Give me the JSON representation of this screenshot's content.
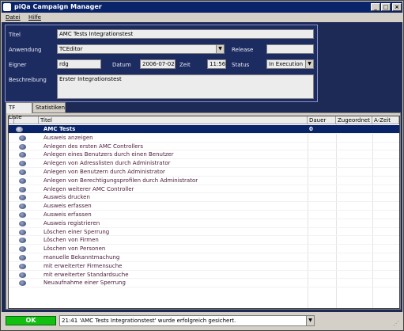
{
  "window": {
    "title": "piQa Campaign Manager"
  },
  "menu": [
    {
      "label": "Datei"
    },
    {
      "label": "Hilfe"
    }
  ],
  "form": {
    "titel_label": "Titel",
    "titel_value": "AMC Tests Integrationstest",
    "anwendung_label": "Anwendung",
    "anwendung_value": "TCEditor",
    "release_label": "Release",
    "release_value": "",
    "eigner_label": "Eigner",
    "eigner_value": "rdg",
    "datum_label": "Datum",
    "datum_value": "2006-07-02",
    "zeit_label": "Zeit",
    "zeit_value": "11:56",
    "status_label": "Status",
    "status_value": "In Execution",
    "beschreibung_label": "Beschreibung",
    "beschreibung_value": "Erster Integrationstest"
  },
  "tabs": [
    {
      "label": "TF Liste",
      "active": true
    },
    {
      "label": "Statistiken",
      "active": false
    }
  ],
  "table": {
    "headers": [
      "Titel",
      "Dauer",
      "Zugeordnet",
      "A-Zeit"
    ],
    "rows": [
      {
        "title": "AMC Tests",
        "dauer": "0",
        "selected": true
      },
      {
        "title": "Ausweis anzeigen",
        "dauer": ""
      },
      {
        "title": "Anlegen des ersten AMC Controllers",
        "dauer": ""
      },
      {
        "title": "Anlegen eines Benutzers durch einen Benutzer",
        "dauer": ""
      },
      {
        "title": "Anlegen von Adresslisten durch Administrator",
        "dauer": ""
      },
      {
        "title": "Anlegen von Benutzern durch Administrator",
        "dauer": ""
      },
      {
        "title": "Anlegen von Berechtigungsprofilen durch Administrator",
        "dauer": ""
      },
      {
        "title": "Anlegen weiterer AMC Controller",
        "dauer": ""
      },
      {
        "title": "Ausweis drucken",
        "dauer": ""
      },
      {
        "title": "Ausweis erfassen",
        "dauer": ""
      },
      {
        "title": "Ausweis erfassen",
        "dauer": ""
      },
      {
        "title": "Ausweis registrieren",
        "dauer": ""
      },
      {
        "title": "Löschen einer Sperrung",
        "dauer": ""
      },
      {
        "title": "Löschen von Firmen",
        "dauer": ""
      },
      {
        "title": "Löschen von Personen",
        "dauer": ""
      },
      {
        "title": "manuelle Bekanntmachung",
        "dauer": ""
      },
      {
        "title": "mit erweiterter Firmensuche",
        "dauer": ""
      },
      {
        "title": "mit erweiterter Standardsuche",
        "dauer": ""
      },
      {
        "title": "Neuaufnahme einer Sperrung",
        "dauer": ""
      }
    ]
  },
  "status": {
    "ok_label": "OK",
    "message": "21:41 'AMC Tests Integrationstest' wurde erfolgreich gesichert."
  },
  "colors": {
    "ok": "#11c011",
    "titlebar": "#0a246a",
    "panel_bg": "#1c2a55",
    "selection": "#0a246a"
  }
}
